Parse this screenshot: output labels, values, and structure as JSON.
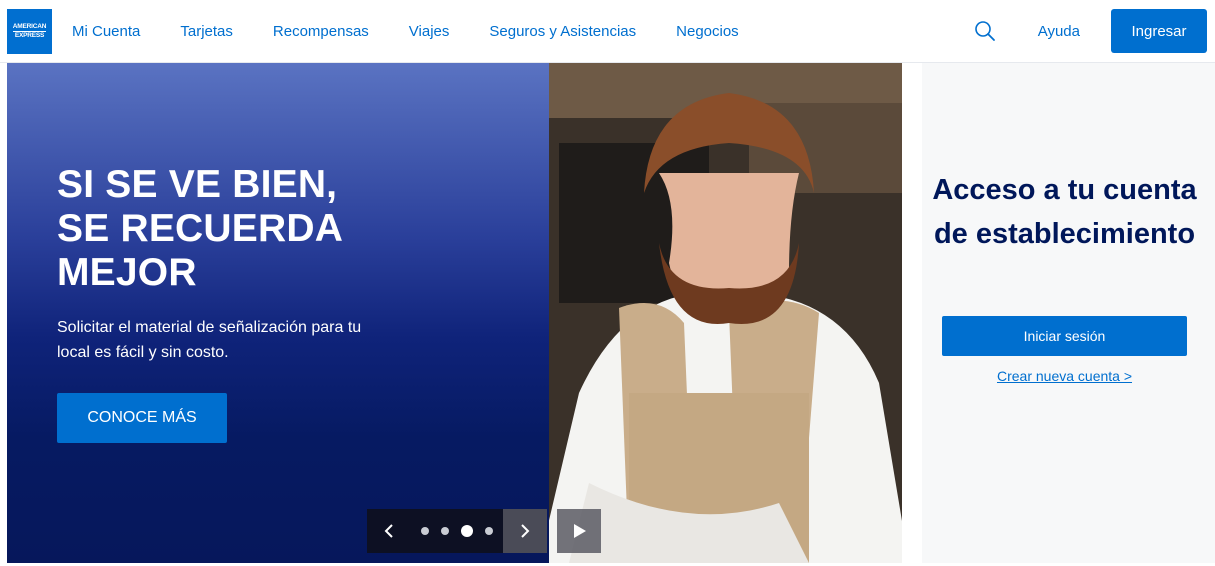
{
  "brand": {
    "logo_line1": "American",
    "logo_line2": "Express",
    "color": "#016fd0"
  },
  "nav": {
    "items": [
      {
        "label": "Mi Cuenta"
      },
      {
        "label": "Tarjetas"
      },
      {
        "label": "Recompensas"
      },
      {
        "label": "Viajes"
      },
      {
        "label": "Seguros y Asistencias"
      },
      {
        "label": "Negocios"
      }
    ],
    "search_icon": "search-icon",
    "help_label": "Ayuda",
    "login_label": "Ingresar"
  },
  "hero": {
    "title_lines": [
      "SI SE VE BIEN,",
      "SE RECUERDA",
      "MEJOR"
    ],
    "subtitle": "Solicitar el material de señalización para tu local es fácil y sin costo.",
    "cta_label": "CONOCE MÁS",
    "image": "man-with-beard-in-apron-photo",
    "carousel": {
      "slide_count": 4,
      "active_index": 2
    }
  },
  "account_panel": {
    "title": "Acceso a tu cuenta de establecimiento",
    "login_label": "Iniciar sesión",
    "create_link": "Crear nueva cuenta >"
  },
  "colors": {
    "accent": "#006fcf",
    "hero_dark": "#06175b",
    "panel_bg": "#f7f8f9",
    "panel_title": "#00175a"
  }
}
